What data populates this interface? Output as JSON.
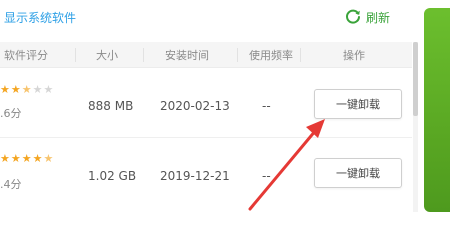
{
  "topbar": {
    "show_system_label": "显示系统软件",
    "refresh_label": "刷新",
    "refresh_icon": "refresh-icon"
  },
  "columns": {
    "rating": "软件评分",
    "size": "大小",
    "install_time": "安装时间",
    "frequency": "使用频率",
    "action": "操作"
  },
  "rows": [
    {
      "stars_filled": 2.5,
      "score": ".6分",
      "size": "888 MB",
      "install_date": "2020-02-13",
      "frequency": "--",
      "action_label": "一键卸载"
    },
    {
      "stars_filled": 4.5,
      "score": ".4分",
      "size": "1.02 GB",
      "install_date": "2019-12-21",
      "frequency": "--",
      "action_label": "一键卸载"
    }
  ],
  "colors": {
    "link_blue": "#2ea0e6",
    "refresh_green": "#3aa33a",
    "star_gold": "#f4a521",
    "arrow_red": "#e53935",
    "panel_green": "#5aa823"
  }
}
